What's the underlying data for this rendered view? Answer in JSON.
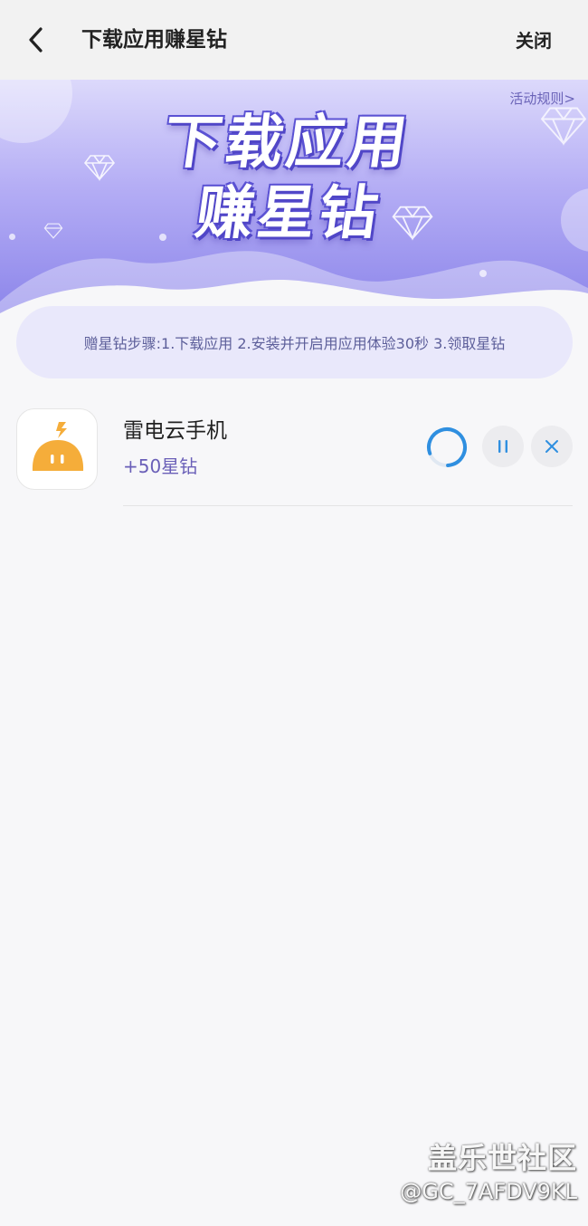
{
  "header": {
    "title": "下载应用赚星钻",
    "close_label": "关闭"
  },
  "banner": {
    "rules_link": "活动规则>",
    "title_line1": "下载应用",
    "title_line2": "赚星钻"
  },
  "steps": {
    "text": "赠星钻步骤:1.下载应用 2.安装并开启用应用体验30秒 3.领取星钻"
  },
  "app": {
    "name": "雷电云手机",
    "reward": "+50星钻",
    "icon": "ldyun-app-icon",
    "brand_color": "#f5ad3a"
  },
  "colors": {
    "accent": "#6a5fb8",
    "progress": "#2f8fe0",
    "banner_dark": "#5046c7"
  },
  "watermark": {
    "logo": "盖乐世社区",
    "user": "@GC_7AFDV9KL"
  }
}
